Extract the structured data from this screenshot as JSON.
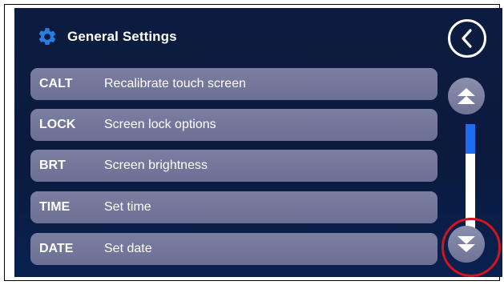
{
  "header": {
    "title": "General Settings",
    "icon": "gear-icon"
  },
  "nav": {
    "back_icon": "chevron-left-icon"
  },
  "settings": [
    {
      "code": "CALT",
      "label": "Recalibrate touch screen"
    },
    {
      "code": "LOCK",
      "label": "Screen lock options"
    },
    {
      "code": "BRT",
      "label": "Screen brightness"
    },
    {
      "code": "TIME",
      "label": "Set time"
    },
    {
      "code": "DATE",
      "label": "Set date"
    }
  ],
  "scroll": {
    "up_icon": "double-chevron-up-icon",
    "down_icon": "double-chevron-down-icon",
    "position_fraction": 0.0,
    "visible_fraction": 0.28
  },
  "annotation": {
    "highlighted_control": "scroll-down",
    "color": "#d2141c"
  },
  "colors": {
    "background": "#0c1c40",
    "row": "#72779a",
    "accent": "#1e6cf0",
    "text": "#ffffff"
  }
}
